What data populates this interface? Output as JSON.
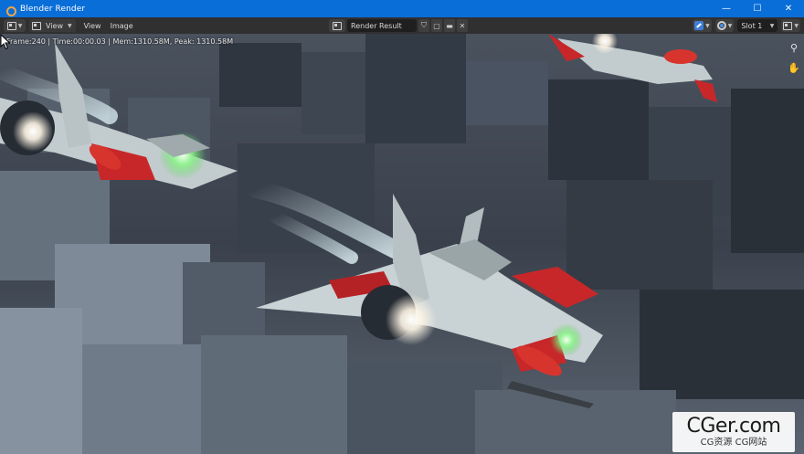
{
  "window": {
    "title": "Blender Render",
    "controls": {
      "minimize": "—",
      "maximize": "☐",
      "close": "✕"
    }
  },
  "header": {
    "menus": [
      "View",
      "View",
      "Image"
    ],
    "image_name": "Render Result",
    "slot": "Slot 1"
  },
  "render_stats": "Frame:240 | Time:00:00.03 | Mem:1310.58M, Peak: 1310.58M",
  "icons": {
    "editor_type": "image-editor-icon",
    "zoom": "zoom-icon",
    "pan": "hand-icon"
  },
  "watermark": {
    "logo": "CGer.com",
    "subtitle": "CG资源  CG网站"
  }
}
